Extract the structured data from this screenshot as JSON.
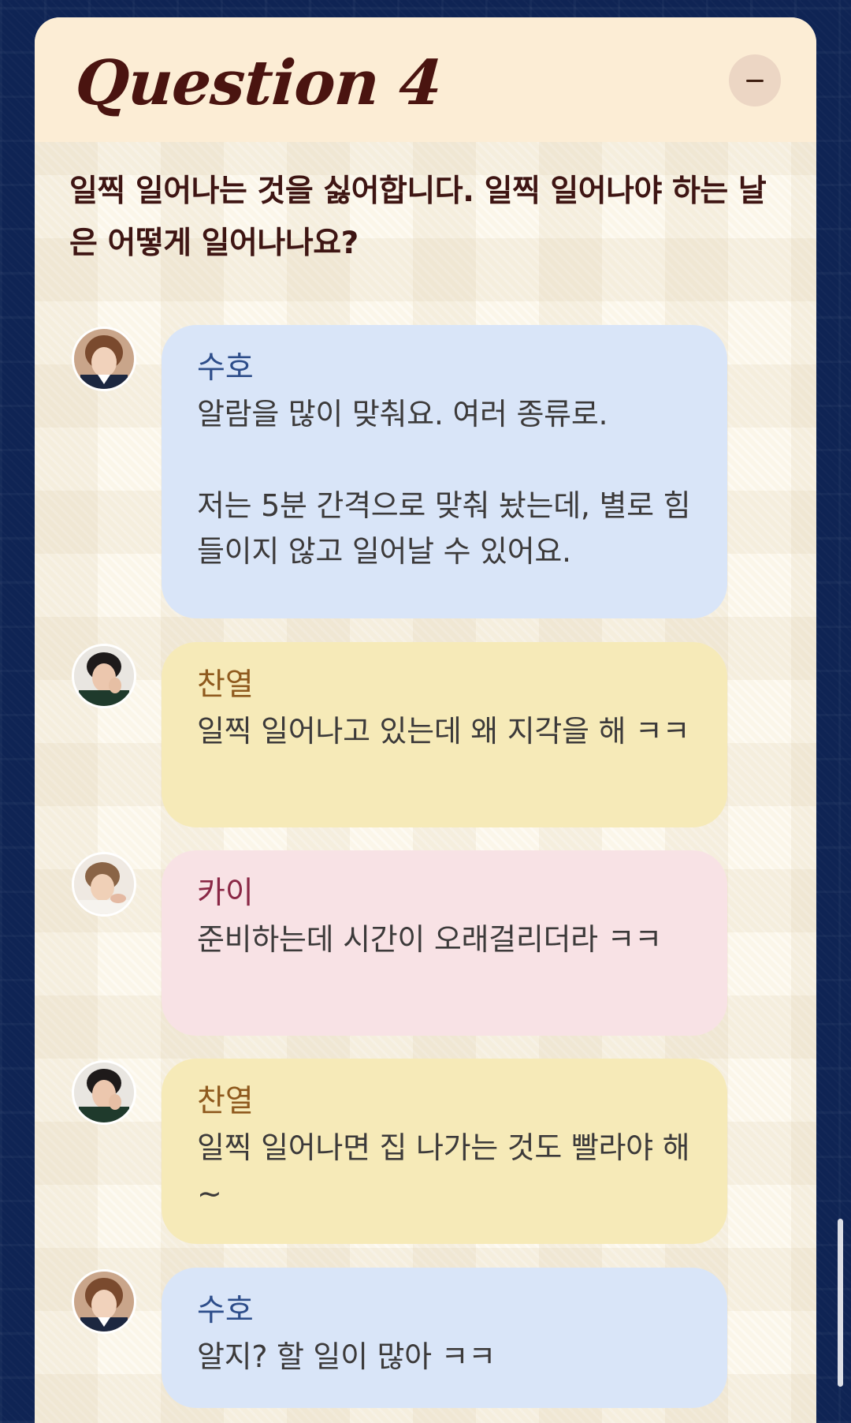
{
  "question_card": {
    "title": "Question 4",
    "collapse_button": "minus-icon",
    "question_text": "일찍 일어나는 것을 싫어합니다. 일찍 일어나야 하는 날은 어떻게 일어나나요?"
  },
  "messages": [
    {
      "speaker": "수호",
      "text": "알람을 많이 맞춰요. 여러 종류로.\n\n저는 5분 간격으로 맞춰 놨는데, 별로 힘들이지 않고 일어날 수 있어요.",
      "bubble_color": "#d9e5f8"
    },
    {
      "speaker": "찬열",
      "text": "일찍 일어나고 있는데 왜 지각을 해 ㅋㅋ",
      "bubble_color": "#f6eab8"
    },
    {
      "speaker": "카이",
      "text": "준비하는데 시간이 오래걸리더라 ㅋㅋ",
      "bubble_color": "#f8e2e5"
    },
    {
      "speaker": "찬열",
      "text": "일찍 일어나면 집 나가는 것도 빨라야 해~",
      "bubble_color": "#f6eab8"
    },
    {
      "speaker": "수호",
      "text": "알지? 할 일이 많아 ㅋㅋ",
      "bubble_color": "#d9e5f8"
    }
  ],
  "colors": {
    "page_background": "#0f2454",
    "card_header": "#fcedd5",
    "title": "#4a1410"
  }
}
